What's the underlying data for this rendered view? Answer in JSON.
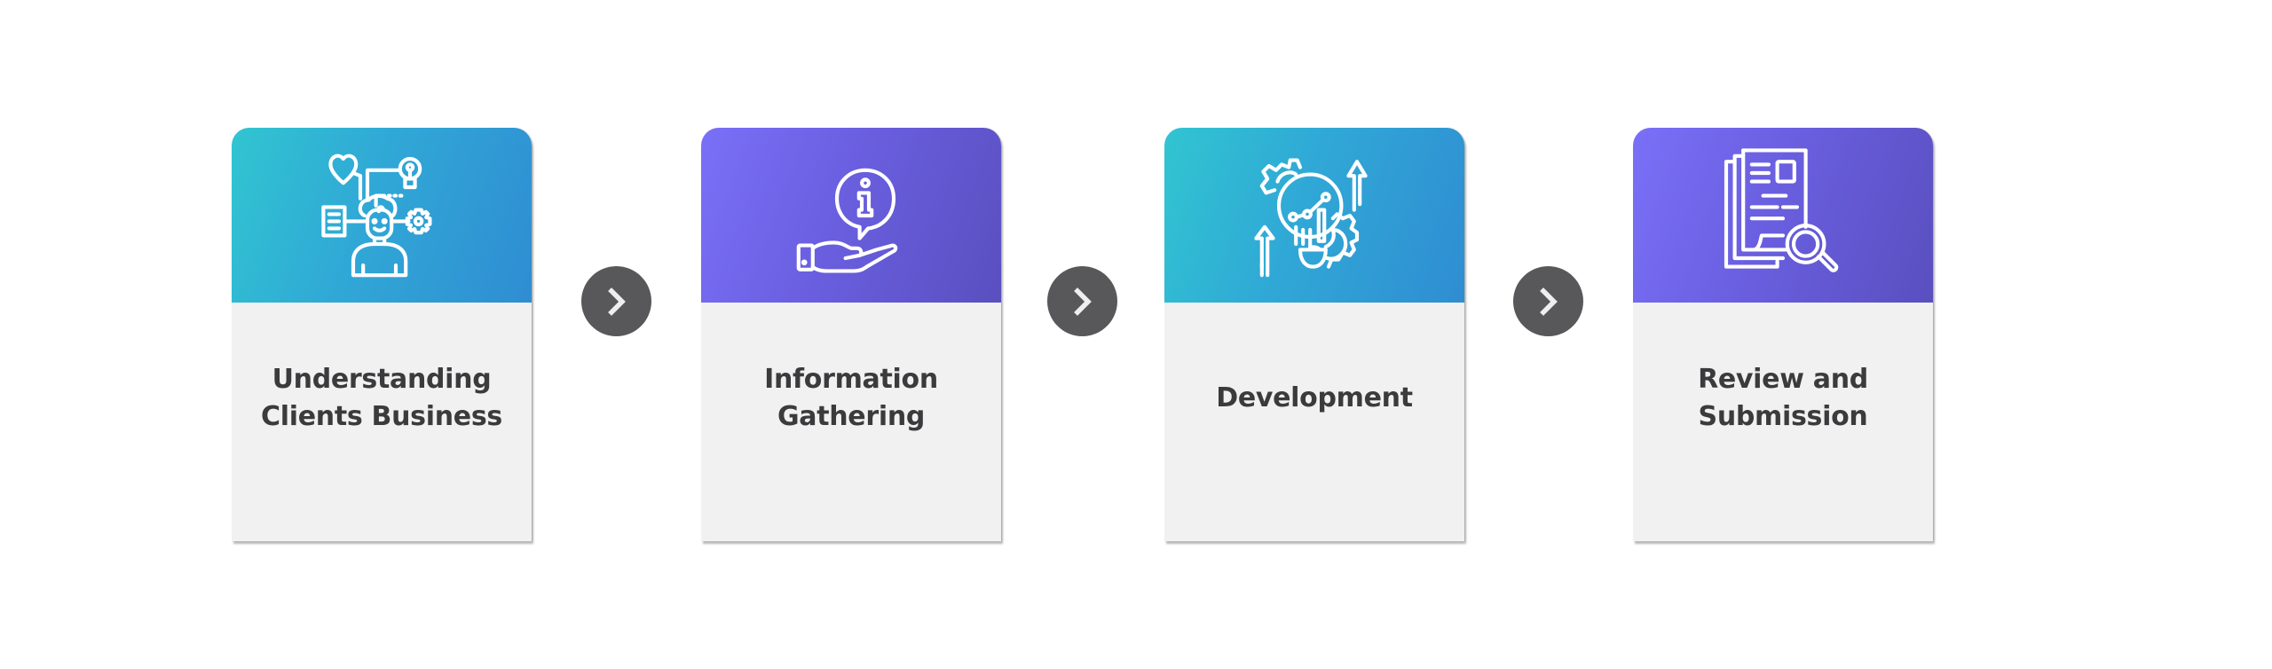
{
  "diagram": {
    "type": "process-flow",
    "direction": "left-to-right",
    "steps": [
      {
        "title_lines": [
          "Understanding",
          "Clients Business"
        ],
        "icon": "customer-insight-icon",
        "header_color": "teal",
        "header_gradient": [
          "#31c5d1",
          "#2f8dd2"
        ]
      },
      {
        "title_lines": [
          "Information",
          "Gathering"
        ],
        "icon": "hand-info-icon",
        "header_color": "purple",
        "header_gradient": [
          "#7a70f8",
          "#5a4fbf"
        ]
      },
      {
        "title_lines": [
          "Development"
        ],
        "icon": "development-growth-icon",
        "header_color": "teal",
        "header_gradient": [
          "#31c5d1",
          "#2f8dd2"
        ]
      },
      {
        "title_lines": [
          "Review and",
          "Submission"
        ],
        "icon": "document-review-icon",
        "header_color": "purple",
        "header_gradient": [
          "#7a70f8",
          "#5a4fbf"
        ]
      }
    ],
    "connectors": [
      {
        "icon": "chevron-right-icon"
      },
      {
        "icon": "chevron-right-icon"
      },
      {
        "icon": "chevron-right-icon"
      }
    ],
    "colors": {
      "card_body": "#f1f1f1",
      "title_text": "#3b3b3d",
      "connector_fill": "#58585a",
      "connector_glyph": "#eeeeee",
      "icon_stroke": "#ffffff"
    }
  }
}
